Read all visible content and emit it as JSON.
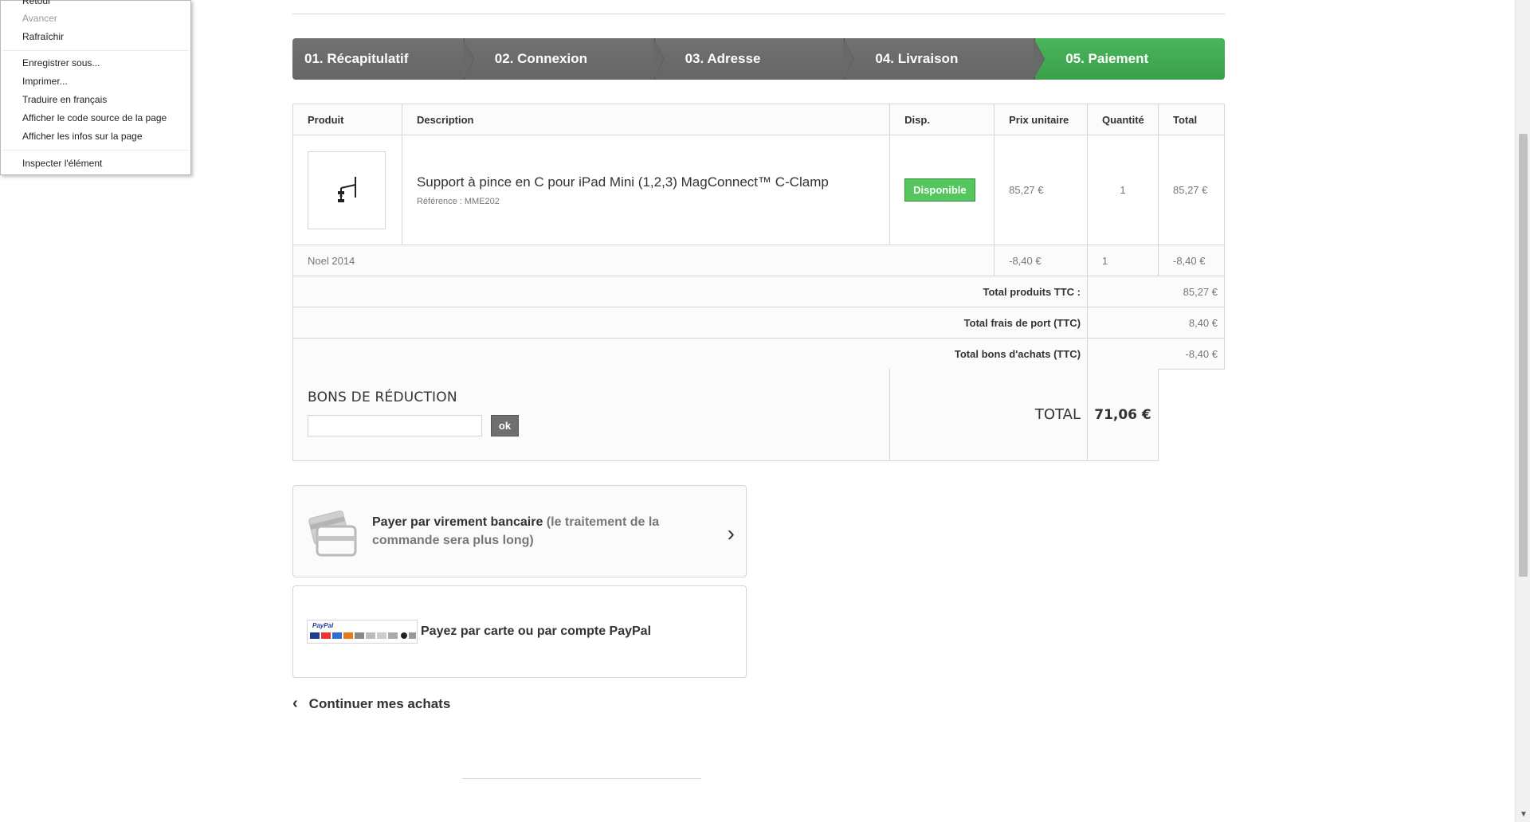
{
  "context_menu": {
    "items": [
      {
        "label": "Retour",
        "disabled": false
      },
      {
        "label": "Avancer",
        "disabled": true
      },
      {
        "label": "Rafraîchir",
        "disabled": false
      },
      {
        "label": "Enregistrer sous...",
        "disabled": false
      },
      {
        "label": "Imprimer...",
        "disabled": false
      },
      {
        "label": "Traduire en français",
        "disabled": false
      },
      {
        "label": "Afficher le code source de la page",
        "disabled": false
      },
      {
        "label": "Afficher les infos sur la page",
        "disabled": false
      },
      {
        "label": "Inspecter l'élément",
        "disabled": false
      }
    ]
  },
  "steps": [
    {
      "label": "01. Récapitulatif"
    },
    {
      "label": "02. Connexion"
    },
    {
      "label": "03. Adresse"
    },
    {
      "label": "04. Livraison"
    },
    {
      "label": "05. Paiement",
      "active": true
    }
  ],
  "cart": {
    "headers": {
      "product": "Produit",
      "description": "Description",
      "availability": "Disp.",
      "unit_price": "Prix unitaire",
      "quantity": "Quantité",
      "total": "Total"
    },
    "item": {
      "name": "Support à pince en C pour iPad Mini (1,2,3) MagConnect™ C-Clamp",
      "reference": "Référence : MME202",
      "availability": "Disponible",
      "unit_price": "85,27 €",
      "quantity": "1",
      "total": "85,27 €"
    },
    "discount": {
      "name": "Noel 2014",
      "unit_price": "-8,40 €",
      "quantity": "1",
      "total": "-8,40 €"
    },
    "totals": {
      "products_label": "Total produits TTC :",
      "products_value": "85,27 €",
      "shipping_label": "Total frais de port (TTC)",
      "shipping_value": "8,40 €",
      "vouchers_label": "Total bons d'achats (TTC)",
      "vouchers_value": "-8,40 €"
    },
    "voucher_title": "BONS DE RÉDUCTION",
    "voucher_button": "ok",
    "voucher_input_value": "",
    "total_label": "TOTAL",
    "total_value": "71,06 €"
  },
  "payment": {
    "bankwire_main": "Payer par virement bancaire",
    "bankwire_note": "(le traitement de la commande sera plus long)",
    "paypal_label": "Payez par carte ou par compte PayPal",
    "paypal_logo_text": "PayPal"
  },
  "continue_label": "Continuer mes achats",
  "colors": {
    "step_active": "#46b058",
    "step_inactive": "#6c6b6b",
    "badge_green": "#55c65e"
  }
}
